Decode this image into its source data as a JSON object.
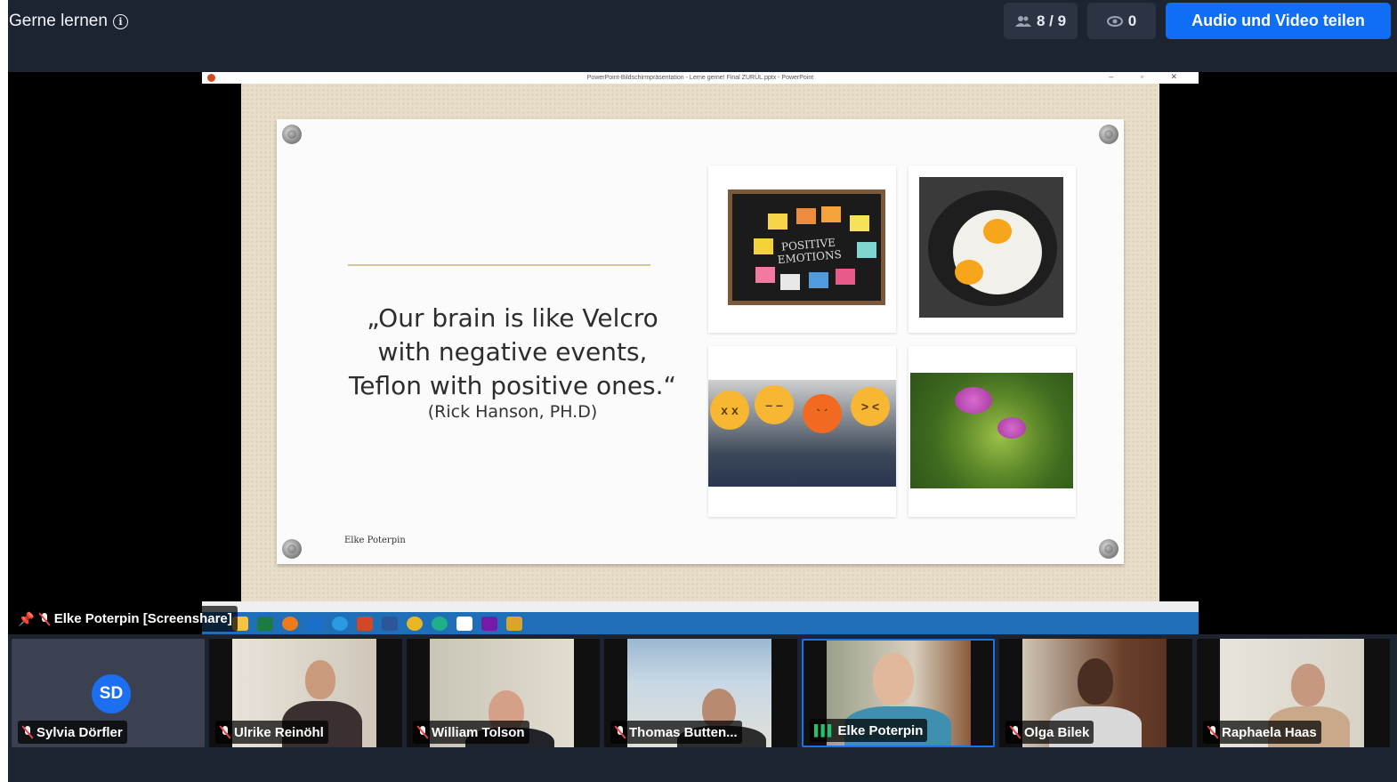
{
  "header": {
    "room_title": "Gerne lernen",
    "participants_count": "8 / 9",
    "viewers_count": "0",
    "share_button_label": "Audio und Video teilen"
  },
  "screenshare": {
    "window_title": "PowerPoint-Bildschirmpräsentation - Lerne gerne! Final ZURÜL.pptx - PowerPoint",
    "label": "Elke Poterpin [Screenshare]"
  },
  "slide": {
    "quote_line1": "„Our brain is like Velcro",
    "quote_line2": "with negative events,",
    "quote_line3": "Teflon with positive ones.“",
    "author": "(Rick Hanson, PH.D)",
    "footer_name": "Elke Poterpin",
    "chalkboard_text_line1": "POSITIVE",
    "chalkboard_text_line2": "EMOTIONS"
  },
  "participants": [
    {
      "name": "Sylvia Dörfler",
      "initials": "SD",
      "mic": "muted",
      "video": false
    },
    {
      "name": "Ulrike Reinöhl",
      "mic": "muted",
      "video": true
    },
    {
      "name": "William Tolson",
      "mic": "muted",
      "video": true
    },
    {
      "name": "Thomas Butten...",
      "mic": "muted",
      "video": true
    },
    {
      "name": "Elke Poterpin",
      "mic": "speaking",
      "video": true,
      "active": true
    },
    {
      "name": "Olga Bilek",
      "mic": "muted",
      "video": true
    },
    {
      "name": "Raphaela Haas",
      "mic": "muted",
      "video": true
    }
  ],
  "colors": {
    "background": "#1c2331",
    "accent": "#0f6ef5",
    "active_border": "#1a73e8",
    "speaking": "#23c16b",
    "muted": "#e5484d"
  },
  "icons": [
    "info-icon",
    "people-icon",
    "eye-icon",
    "pin-icon",
    "mic-muted-icon",
    "mic-active-icon"
  ]
}
